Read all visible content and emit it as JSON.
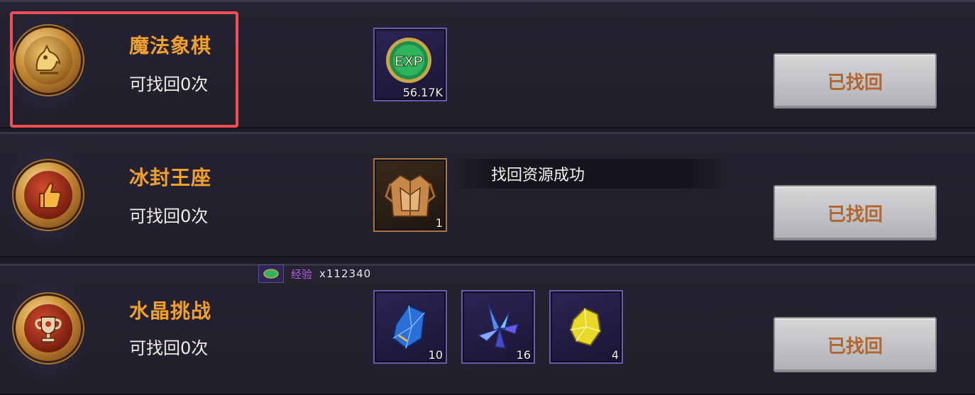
{
  "rows": [
    {
      "title": "魔法象棋",
      "subtitle": "可找回0次",
      "button_label": "已找回",
      "medal_icon": "gold-dragon-icon",
      "rewards": [
        {
          "icon": "exp-coin-icon",
          "count": "56.17K"
        }
      ]
    },
    {
      "title": "冰封王座",
      "subtitle": "可找回0次",
      "button_label": "已找回",
      "medal_icon": "thumbs-up-icon",
      "rewards": [
        {
          "icon": "golden-armor-icon",
          "count": "1"
        }
      ]
    },
    {
      "title": "水晶挑战",
      "subtitle": "可找回0次",
      "button_label": "已找回",
      "medal_icon": "trophy-cup-icon",
      "rewards": [
        {
          "icon": "blue-crystal-icon",
          "count": "10"
        },
        {
          "icon": "purple-crystal-cluster-icon",
          "count": "16"
        },
        {
          "icon": "yellow-crystal-icon",
          "count": "4"
        }
      ]
    }
  ],
  "toast": {
    "text": "找回资源成功"
  },
  "exp_gain": {
    "label": "经验",
    "value": "x112340",
    "icon": "exp-mini-icon"
  },
  "colors": {
    "title": "#f0a12c",
    "highlight": "#f05055",
    "button_text": "#b3652f"
  }
}
